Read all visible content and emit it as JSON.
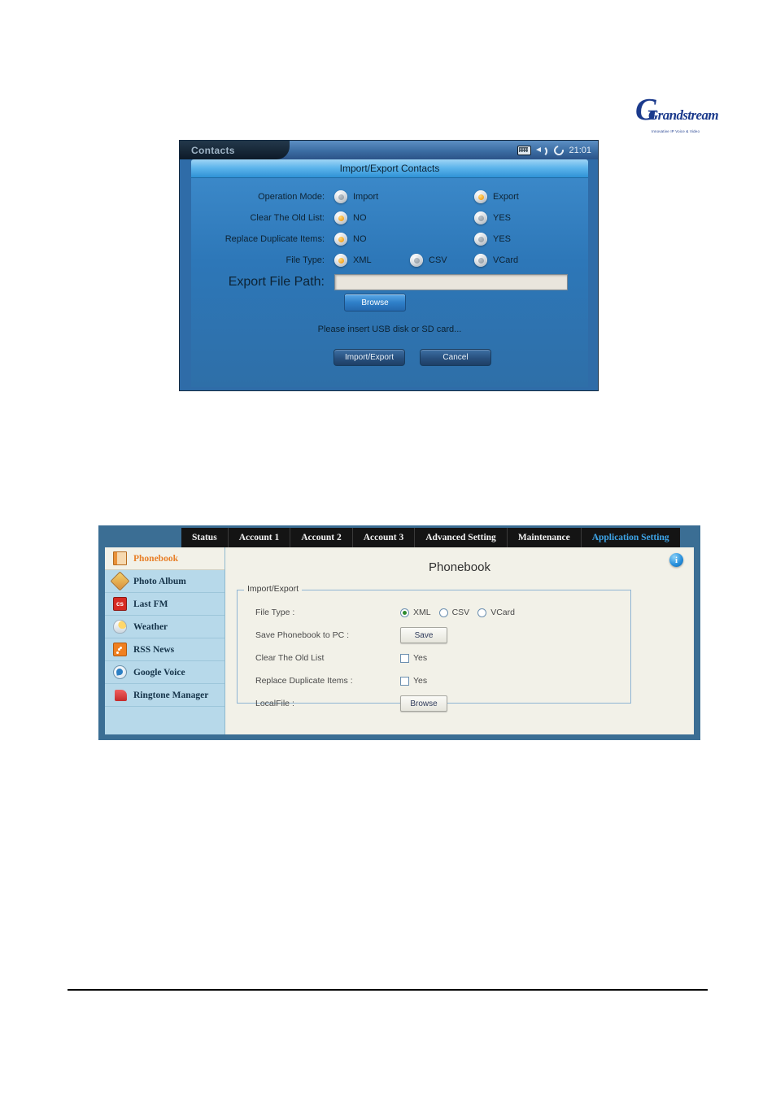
{
  "logo": {
    "name": "Grandstream",
    "tagline": "Innovative IP Voice & Video"
  },
  "phone_screen": {
    "tab_label": "Contacts",
    "status": {
      "keyboard_icon": "keyboard-icon",
      "speaker_icon": "speaker-icon",
      "circle_icon": "refresh-circle-icon",
      "time": "21:01"
    },
    "dialog_title": "Import/Export Contacts",
    "rows": [
      {
        "label": "Operation Mode:",
        "options": [
          {
            "label": "Import",
            "selected": false
          },
          {
            "label": "Export",
            "selected": true
          }
        ]
      },
      {
        "label": "Clear The Old List:",
        "options": [
          {
            "label": "NO",
            "selected": true
          },
          {
            "label": "YES",
            "selected": false
          }
        ]
      },
      {
        "label": "Replace Duplicate Items:",
        "options": [
          {
            "label": "NO",
            "selected": true
          },
          {
            "label": "YES",
            "selected": false
          }
        ]
      },
      {
        "label": "File Type:",
        "options": [
          {
            "label": "XML",
            "selected": true
          },
          {
            "label": "CSV",
            "selected": false
          },
          {
            "label": "VCard",
            "selected": false
          }
        ]
      }
    ],
    "path_label": "Export File Path:",
    "path_value": "",
    "browse_label": "Browse",
    "hint": "Please insert USB disk or SD card...",
    "primary_button": "Import/Export",
    "cancel_button": "Cancel"
  },
  "webui": {
    "tabs": [
      {
        "label": "Status",
        "active": false
      },
      {
        "label": "Account 1",
        "active": false
      },
      {
        "label": "Account 2",
        "active": false
      },
      {
        "label": "Account 3",
        "active": false
      },
      {
        "label": "Advanced Setting",
        "active": false
      },
      {
        "label": "Maintenance",
        "active": false
      },
      {
        "label": "Application Setting",
        "active": true
      }
    ],
    "sidebar": [
      {
        "label": "Phonebook",
        "icon": "book-icon",
        "active": true
      },
      {
        "label": "Photo Album",
        "icon": "photo-icon",
        "active": false
      },
      {
        "label": "Last FM",
        "icon": "lastfm-icon",
        "active": false
      },
      {
        "label": "Weather",
        "icon": "weather-icon",
        "active": false
      },
      {
        "label": "RSS News",
        "icon": "rss-icon",
        "active": false
      },
      {
        "label": "Google Voice",
        "icon": "google-voice-icon",
        "active": false
      },
      {
        "label": "Ringtone Manager",
        "icon": "ringtone-icon",
        "active": false
      }
    ],
    "page_title": "Phonebook",
    "info_icon_label": "i",
    "fieldset_legend": "Import/Export",
    "file_type_label": "File Type :",
    "file_type_options": [
      {
        "label": "XML",
        "selected": true
      },
      {
        "label": "CSV",
        "selected": false
      },
      {
        "label": "VCard",
        "selected": false
      }
    ],
    "save_to_pc_label": "Save Phonebook to PC :",
    "save_button": "Save",
    "clear_old_list_label": "Clear The Old List",
    "clear_old_list_option": "Yes",
    "clear_old_list_checked": false,
    "replace_duplicate_label": "Replace Duplicate Items :",
    "replace_duplicate_option": "Yes",
    "replace_duplicate_checked": false,
    "local_file_label": "LocalFile :",
    "local_file_button": "Browse"
  }
}
